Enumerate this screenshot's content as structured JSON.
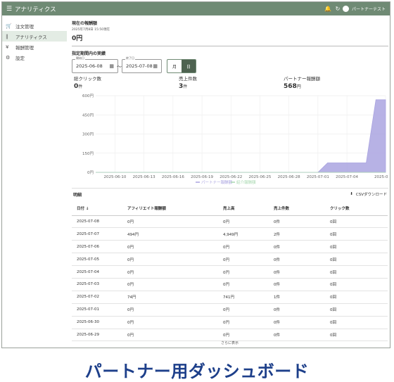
{
  "appbar": {
    "title": "アナリティクス",
    "user_name": "パートナーテスト"
  },
  "sidebar": {
    "items": [
      {
        "label": "注文管理",
        "icon": "cart-icon",
        "glyph": "🛒"
      },
      {
        "label": "アナリティクス",
        "icon": "bar-chart-icon",
        "glyph": "❙"
      },
      {
        "label": "報酬管理",
        "icon": "yen-icon",
        "glyph": "¥"
      },
      {
        "label": "設定",
        "icon": "gear-icon",
        "glyph": "⚙"
      }
    ]
  },
  "current": {
    "title": "現在の報酬額",
    "updated": "2025年7月8日 15:50現在",
    "value": "0円"
  },
  "period": {
    "title": "指定期間内の実績",
    "start_label": "開始日",
    "start_value": "2025-06-08",
    "tilde": "〜",
    "end_label": "終了日",
    "end_value": "2025-07-08",
    "month_label": "月",
    "day_label": "日"
  },
  "stats": [
    {
      "label": "総クリック数",
      "value": "0",
      "unit": "件"
    },
    {
      "label": "売上件数",
      "value": "3",
      "unit": "件"
    },
    {
      "label": "パートナー報酬額",
      "value": "568",
      "unit": "円"
    }
  ],
  "chart_data": {
    "type": "area",
    "x": [
      "2025-06-08",
      "2025-06-09",
      "2025-06-10",
      "2025-06-11",
      "2025-06-12",
      "2025-06-13",
      "2025-06-14",
      "2025-06-15",
      "2025-06-16",
      "2025-06-17",
      "2025-06-18",
      "2025-06-19",
      "2025-06-20",
      "2025-06-21",
      "2025-06-22",
      "2025-06-23",
      "2025-06-24",
      "2025-06-25",
      "2025-06-26",
      "2025-06-27",
      "2025-06-28",
      "2025-06-29",
      "2025-06-30",
      "2025-07-01",
      "2025-07-02",
      "2025-07-03",
      "2025-07-04",
      "2025-07-05",
      "2025-07-06",
      "2025-07-07",
      "2025-07-08"
    ],
    "xticks": [
      "2025-06-10",
      "2025-06-13",
      "2025-06-16",
      "2025-06-19",
      "2025-06-22",
      "2025-06-25",
      "2025-06-28",
      "2025-07-01",
      "2025-07-04",
      "2025-07-08"
    ],
    "yticks": [
      "0円",
      "150円",
      "300円",
      "450円",
      "600円"
    ],
    "ylim": [
      0,
      600
    ],
    "series": [
      {
        "name": "パートナー報酬額",
        "color": "#aaa4e0",
        "values": [
          0,
          0,
          0,
          0,
          0,
          0,
          0,
          0,
          0,
          0,
          0,
          0,
          0,
          0,
          0,
          0,
          0,
          0,
          0,
          0,
          0,
          0,
          0,
          0,
          74,
          74,
          74,
          74,
          74,
          568,
          568
        ]
      },
      {
        "name": "紹介報酬額",
        "color": "#a8d8b0",
        "values": [
          0,
          0,
          0,
          0,
          0,
          0,
          0,
          0,
          0,
          0,
          0,
          0,
          0,
          0,
          0,
          0,
          0,
          0,
          0,
          0,
          0,
          0,
          0,
          0,
          0,
          0,
          0,
          0,
          0,
          0,
          0
        ]
      }
    ],
    "grid": true,
    "legend": "bottom"
  },
  "detail": {
    "title": "明細",
    "csv_label": "CSVダウンロード",
    "columns": [
      "日付 ↓",
      "アフィリエイト報酬額",
      "売上高",
      "売上件数",
      "クリック数"
    ],
    "rows": [
      [
        "2025-07-08",
        "0円",
        "0円",
        "0件",
        "0回"
      ],
      [
        "2025-07-07",
        "494円",
        "4,949円",
        "2件",
        "0回"
      ],
      [
        "2025-07-06",
        "0円",
        "0円",
        "0件",
        "0回"
      ],
      [
        "2025-07-05",
        "0円",
        "0円",
        "0件",
        "0回"
      ],
      [
        "2025-07-04",
        "0円",
        "0円",
        "0件",
        "0回"
      ],
      [
        "2025-07-03",
        "0円",
        "0円",
        "0件",
        "0回"
      ],
      [
        "2025-07-02",
        "74円",
        "741円",
        "1件",
        "0回"
      ],
      [
        "2025-07-01",
        "0円",
        "0円",
        "0件",
        "0回"
      ],
      [
        "2025-06-30",
        "0円",
        "0円",
        "0件",
        "0回"
      ],
      [
        "2025-06-29",
        "0円",
        "0円",
        "0件",
        "0回"
      ]
    ],
    "more_label": "さらに表示"
  },
  "caption": "パートナー用ダッシュボード"
}
